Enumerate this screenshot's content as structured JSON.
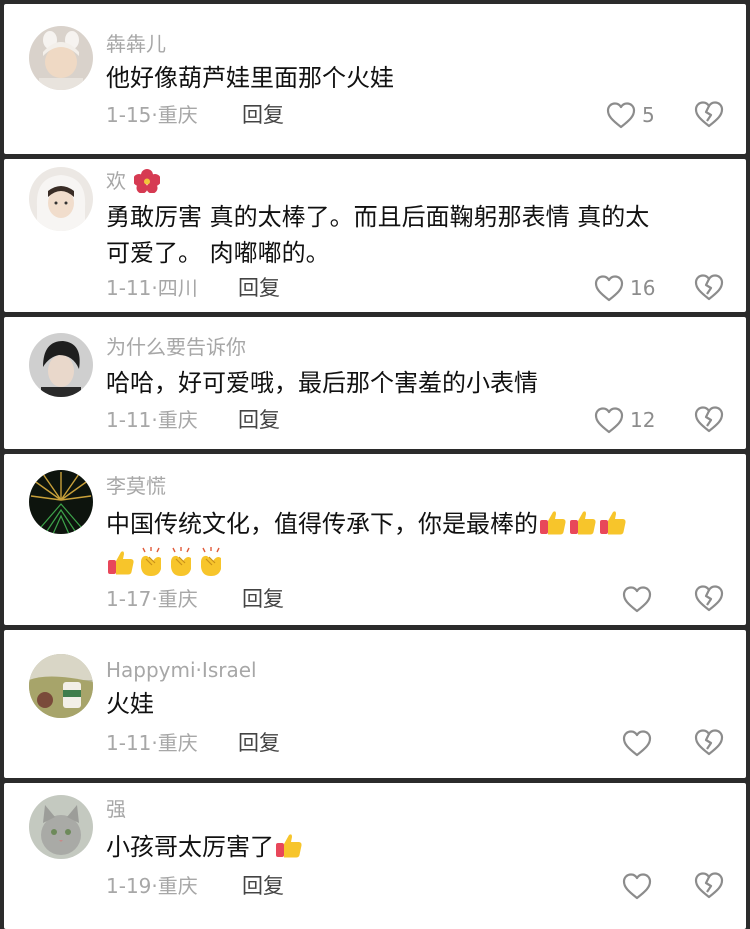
{
  "comments": [
    {
      "username": "犇犇儿",
      "username_flower": false,
      "text": "他好像葫芦娃里面那个火娃",
      "text_line2": "",
      "text_line2_emojis": [],
      "text_emojis": [],
      "date": "1-15",
      "location": "重庆",
      "reply": "回复",
      "likes": "5"
    },
    {
      "username": "欢",
      "username_flower": true,
      "text": "勇敢厉害 真的太棒了。而且后面鞠躬那表情 真的太",
      "text_line2": "可爱了。 肉嘟嘟的。",
      "text_line2_emojis": [],
      "text_emojis": [],
      "date": "1-11",
      "location": "四川",
      "reply": "回复",
      "likes": "16"
    },
    {
      "username": "为什么要告诉你",
      "username_flower": false,
      "text": "哈哈，好可爱哦，最后那个害羞的小表情",
      "text_line2": "",
      "text_line2_emojis": [],
      "text_emojis": [],
      "date": "1-11",
      "location": "重庆",
      "reply": "回复",
      "likes": "12"
    },
    {
      "username": "李莫慌",
      "username_flower": false,
      "text": "中国传统文化，值得传承下，你是最棒的",
      "text_line2": "",
      "text_emojis": [
        "thumbs-up",
        "thumbs-up",
        "thumbs-up"
      ],
      "text_line2_emojis": [
        "thumbs-up",
        "clap",
        "clap",
        "clap"
      ],
      "date": "1-17",
      "location": "重庆",
      "reply": "回复",
      "likes": ""
    },
    {
      "username": "Happymi·Israel",
      "username_flower": false,
      "text": "火娃",
      "text_line2": "",
      "text_line2_emojis": [],
      "text_emojis": [],
      "date": "1-11",
      "location": "重庆",
      "reply": "回复",
      "likes": ""
    },
    {
      "username": "强",
      "username_flower": false,
      "text": "小孩哥太厉害了",
      "text_line2": "",
      "text_line2_emojis": [],
      "text_emojis": [
        "thumbs-up"
      ],
      "date": "1-19",
      "location": "重庆",
      "reply": "回复",
      "likes": ""
    }
  ],
  "colors": {
    "background": "#2b2b2b",
    "card": "#ffffff",
    "username": "#a7a7a7",
    "text": "#111111",
    "meta": "#a7a7a7",
    "icon": "#8c8c8c"
  },
  "icons": {
    "like": "heart-outline-icon",
    "dislike": "broken-heart-icon",
    "flower": "hibiscus-emoji",
    "thumbs": "thumbs-up-emoji",
    "clap": "clapping-hands-emoji"
  }
}
